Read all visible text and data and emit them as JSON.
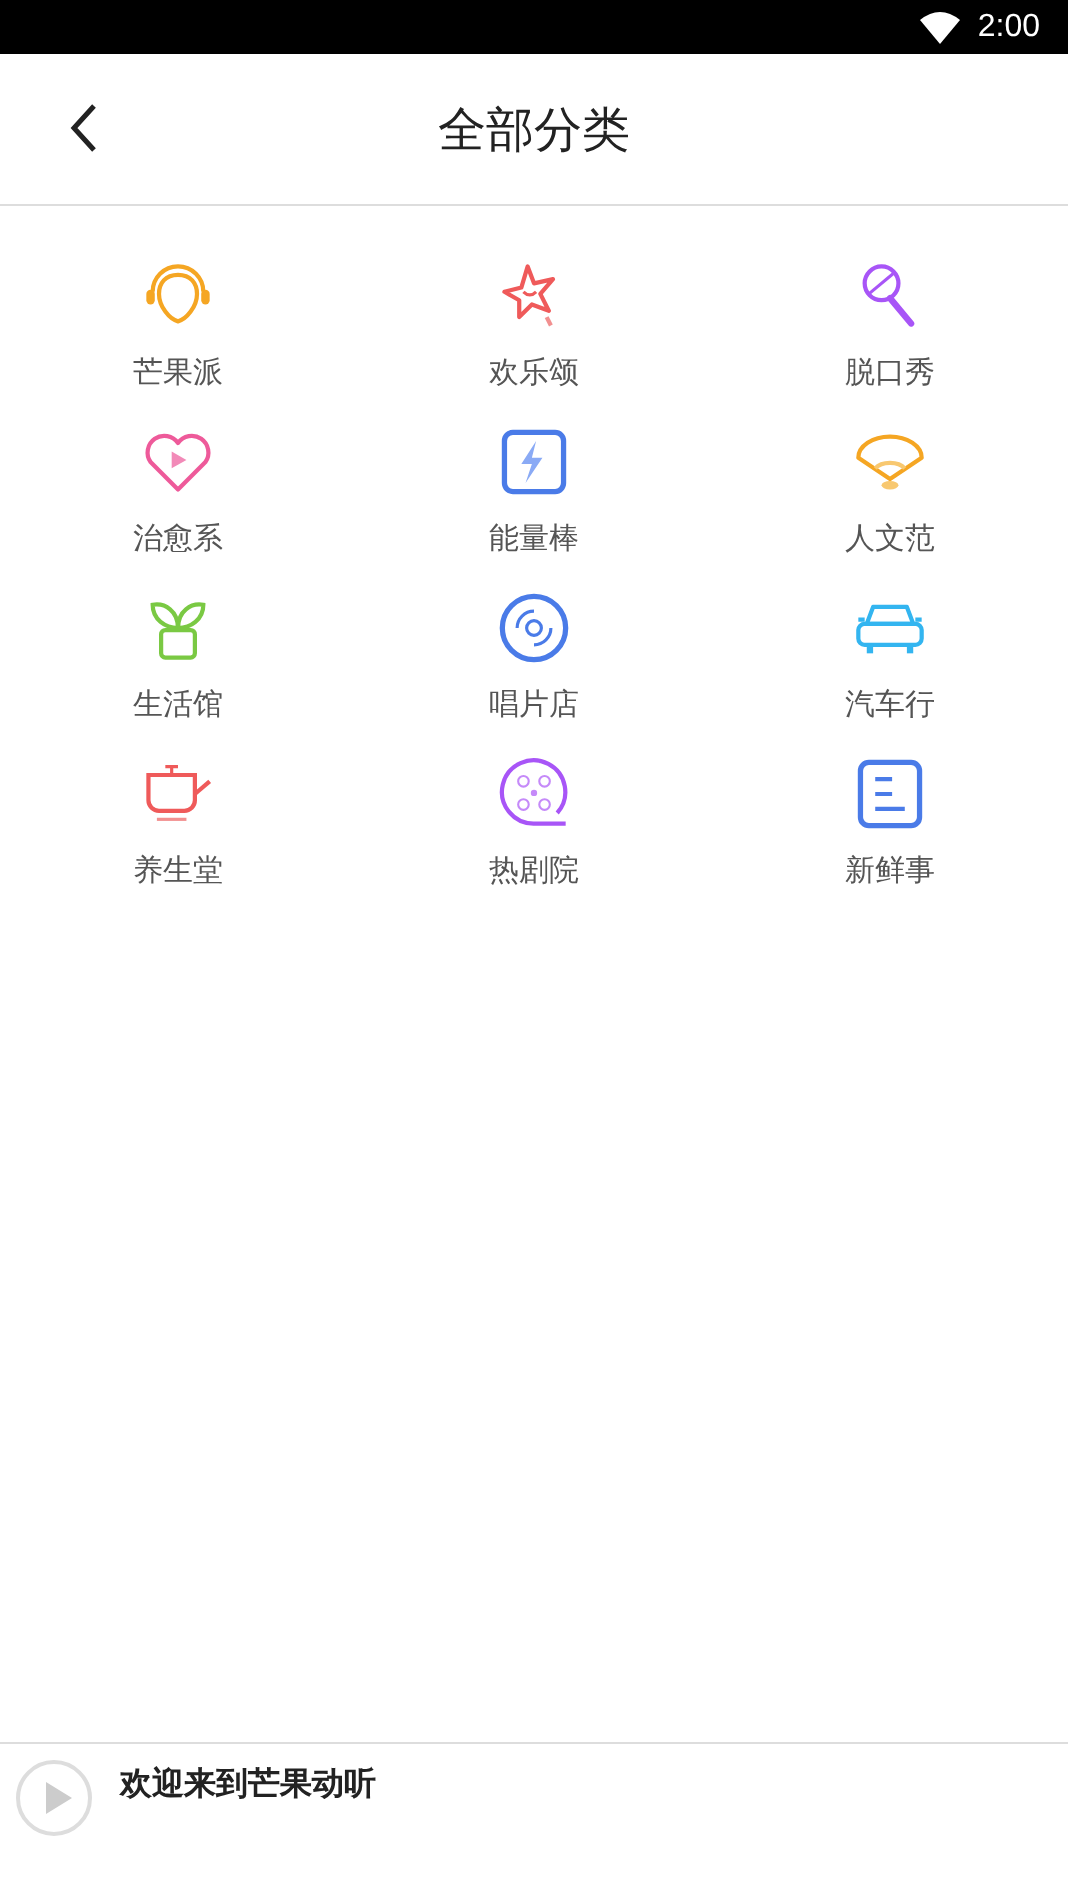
{
  "status_bar": {
    "time": "2:00"
  },
  "header": {
    "title": "全部分类"
  },
  "categories": [
    {
      "label": "芒果派"
    },
    {
      "label": "欢乐颂"
    },
    {
      "label": "脱口秀"
    },
    {
      "label": "治愈系"
    },
    {
      "label": "能量棒"
    },
    {
      "label": "人文范"
    },
    {
      "label": "生活馆"
    },
    {
      "label": "唱片店"
    },
    {
      "label": "汽车行"
    },
    {
      "label": "养生堂"
    },
    {
      "label": "热剧院"
    },
    {
      "label": "新鲜事"
    }
  ],
  "player": {
    "title": "欢迎来到芒果动听"
  }
}
